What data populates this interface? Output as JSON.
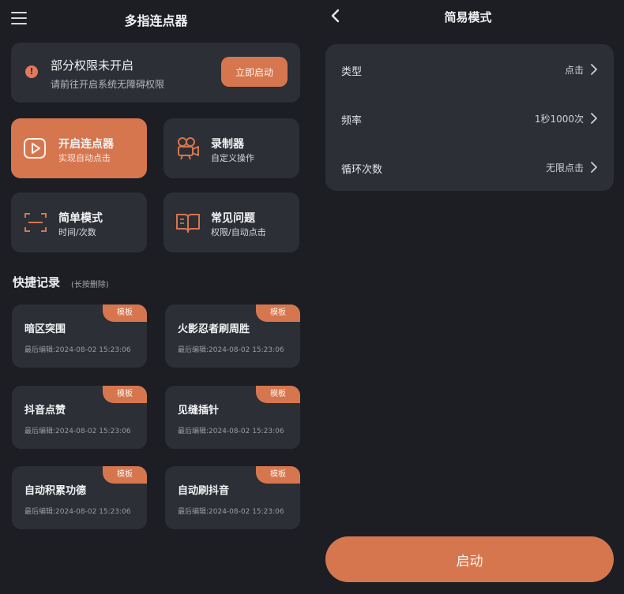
{
  "colors": {
    "background": "#1c1e24",
    "card": "#2c2f36",
    "accent": "#d6764f"
  },
  "left": {
    "title": "多指连点器",
    "permission": {
      "icon": "warning-icon",
      "title": "部分权限未开启",
      "subtitle": "请前往开启系统无障碍权限",
      "button": "立即启动"
    },
    "tiles": [
      {
        "icon": "play-icon",
        "title": "开启连点器",
        "subtitle": "实现自动点击"
      },
      {
        "icon": "camera-icon",
        "title": "录制器",
        "subtitle": "自定义操作"
      },
      {
        "icon": "scan-icon",
        "title": "简单模式",
        "subtitle": "时间/次数"
      },
      {
        "icon": "book-icon",
        "title": "常见问题",
        "subtitle": "权限/自动点击"
      }
    ],
    "records_title": "快捷记录",
    "records_hint": "(长按删除)",
    "records": [
      {
        "name": "暗区突围",
        "time": "最后编辑:2024-08-02 15:23:06",
        "badge": "模板"
      },
      {
        "name": "火影忍者刷周胜",
        "time": "最后编辑:2024-08-02 15:23:06",
        "badge": "模板"
      },
      {
        "name": "抖音点赞",
        "time": "最后编辑:2024-08-02 15:23:06",
        "badge": "模板"
      },
      {
        "name": "见缝插针",
        "time": "最后编辑:2024-08-02 15:23:06",
        "badge": "模板"
      },
      {
        "name": "自动积累功德",
        "time": "最后编辑:2024-08-02 15:23:06",
        "badge": "模板"
      },
      {
        "name": "自动刷抖音",
        "time": "最后编辑:2024-08-02 15:23:06",
        "badge": "模板"
      }
    ]
  },
  "right": {
    "title": "简易模式",
    "settings": [
      {
        "label": "类型",
        "value": "点击"
      },
      {
        "label": "频率",
        "value": "1秒1000次"
      },
      {
        "label": "循环次数",
        "value": "无限点击"
      }
    ],
    "start_button": "启动"
  }
}
